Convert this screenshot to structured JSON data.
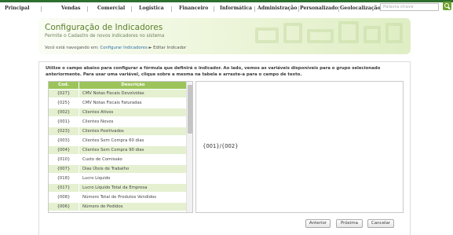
{
  "nav": {
    "items": [
      "Principal",
      "Vendas",
      "Comercial",
      "Logística",
      "Financeiro",
      "Informática",
      "Administração",
      "Personalizado",
      "Geolocalização"
    ],
    "search_placeholder": "Palavra chave"
  },
  "header": {
    "title": "Configuração de Indicadores",
    "subtitle": "Permite o Cadastro de novos indicadores no sistema"
  },
  "breadcrumb": {
    "prefix": "Você está navegando em:",
    "link": "Configurar Indicadores",
    "separator": "►",
    "current": "Editar Indicador"
  },
  "instructions": "Utilize o campo abaixo para configurar a fórmula que definirá o indicador. Ao lado, vemos as variáveis disponíveis para o grupo selecionado anteriormente. Para usar uma variável, clique sobre a mesma na tabela e arraste-a para o campo de texto.",
  "table": {
    "headers": [
      "Cod.",
      "Descrição"
    ],
    "rows": [
      {
        "code": "{027}",
        "desc": "CMV Notas Fiscais Devolvidas"
      },
      {
        "code": "{025}",
        "desc": "CMV Notas Fiscais Faturadas"
      },
      {
        "code": "{002}",
        "desc": "Clientes Ativos"
      },
      {
        "code": "{001}",
        "desc": "Clientes Novos"
      },
      {
        "code": "{023}",
        "desc": "Clientes Positivados"
      },
      {
        "code": "{003}",
        "desc": "Clientes Sem Compra 60 dias"
      },
      {
        "code": "{004}",
        "desc": "Clientes Sem Compra 90 dias"
      },
      {
        "code": "{010}",
        "desc": "Custo de Comissão"
      },
      {
        "code": "{007}",
        "desc": "Dias Úteis de Trabalho"
      },
      {
        "code": "{018}",
        "desc": "Lucro Líquido"
      },
      {
        "code": "{017}",
        "desc": "Lucro Líquido Total da Empresa"
      },
      {
        "code": "{008}",
        "desc": "Número Total de Produtos Vendidos"
      },
      {
        "code": "{006}",
        "desc": "Número de Pedidos"
      }
    ]
  },
  "formula": {
    "value": "{001}/{002}"
  },
  "buttons": {
    "previous": "Anterior",
    "next": "Próxima",
    "cancel": "Cancelar"
  },
  "colors": {
    "accent_green": "#9cc45a",
    "row_alt": "#e4f0d0",
    "title_green": "#5b7f2a",
    "link_blue": "#2e6ea6"
  }
}
